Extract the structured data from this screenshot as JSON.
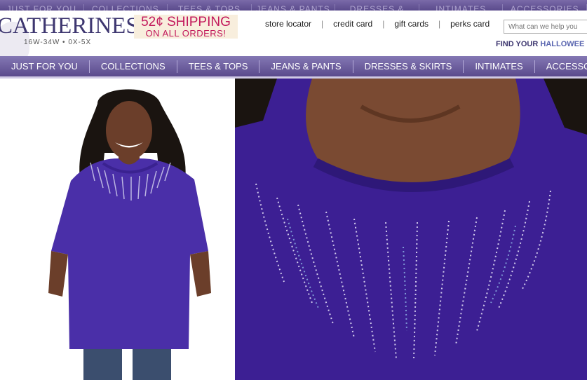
{
  "brand": {
    "logo": "CATHERINES",
    "tagline": "16W-34W • 0X-5X"
  },
  "promo": {
    "line1": "52¢ SHIPPING",
    "line2": "ON ALL ORDERS!"
  },
  "utility_links": [
    "store locator",
    "credit card",
    "gift cards",
    "perks card"
  ],
  "search": {
    "placeholder": "What can we help you"
  },
  "find_your": {
    "prefix": "FIND YOUR",
    "highlight": "HALLOWEE"
  },
  "nav": {
    "items": [
      "JUST FOR YOU",
      "COLLECTIONS",
      "TEES  & TOPS",
      "JEANS & PANTS",
      "DRESSES & SKIRTS",
      "INTIMATES",
      "ACCESSORIES"
    ]
  },
  "colors": {
    "brand": "#3e3770",
    "nav": "#6a5a9c",
    "promo_text": "#c2185b",
    "shirt": "#4a2fa8"
  }
}
